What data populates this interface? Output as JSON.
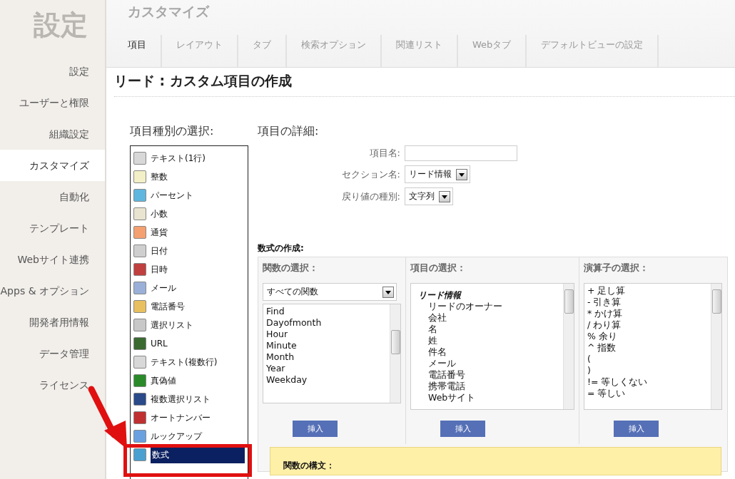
{
  "sidebar": {
    "heading": "設定",
    "items": [
      {
        "label": "設定",
        "selected": false
      },
      {
        "label": "ユーザーと権限",
        "selected": false
      },
      {
        "label": "組織設定",
        "selected": false
      },
      {
        "label": "カスタマイズ",
        "selected": true
      },
      {
        "label": "自動化",
        "selected": false
      },
      {
        "label": "テンプレート",
        "selected": false
      },
      {
        "label": "Webサイト連携",
        "selected": false
      },
      {
        "label": "Apps & オプション",
        "selected": false
      },
      {
        "label": "開発者用情報",
        "selected": false
      },
      {
        "label": "データ管理",
        "selected": false
      },
      {
        "label": "ライセンス",
        "selected": false
      }
    ]
  },
  "header": {
    "title": "カスタマイズ",
    "tabs": [
      {
        "label": "項目",
        "selected": true
      },
      {
        "label": "レイアウト",
        "selected": false
      },
      {
        "label": "タブ",
        "selected": false
      },
      {
        "label": "検索オプション",
        "selected": false
      },
      {
        "label": "関連リスト",
        "selected": false
      },
      {
        "label": "Webタブ",
        "selected": false
      },
      {
        "label": "デフォルトビューの設定",
        "selected": false
      }
    ]
  },
  "page_title": "リード : カスタム項目の作成",
  "field_types": {
    "heading": "項目種別の選択:",
    "items": [
      {
        "label": "テキスト(1行)",
        "selected": false
      },
      {
        "label": "整数",
        "selected": false
      },
      {
        "label": "パーセント",
        "selected": false
      },
      {
        "label": "小数",
        "selected": false
      },
      {
        "label": "通貨",
        "selected": false
      },
      {
        "label": "日付",
        "selected": false
      },
      {
        "label": "日時",
        "selected": false
      },
      {
        "label": "メール",
        "selected": false
      },
      {
        "label": "電話番号",
        "selected": false
      },
      {
        "label": "選択リスト",
        "selected": false
      },
      {
        "label": "URL",
        "selected": false
      },
      {
        "label": "テキスト(複数行)",
        "selected": false
      },
      {
        "label": "真偽値",
        "selected": false
      },
      {
        "label": "複数選択リスト",
        "selected": false
      },
      {
        "label": "オートナンバー",
        "selected": false
      },
      {
        "label": "ルックアップ",
        "selected": false
      },
      {
        "label": "数式",
        "selected": true
      }
    ]
  },
  "details": {
    "heading": "項目の詳細:",
    "fields": [
      {
        "label": "項目名:",
        "kind": "text"
      },
      {
        "label": "セクション名:",
        "kind": "select",
        "value": "リード情報"
      },
      {
        "label": "戻り値の種別:",
        "kind": "select",
        "value": "文字列"
      }
    ]
  },
  "formula": {
    "heading": "数式の作成:",
    "columns": [
      {
        "heading": "関数の選択：",
        "dropdown": "すべての関数",
        "items": [
          "Find",
          "Dayofmonth",
          "Hour",
          "Minute",
          "Month",
          "Year",
          "Weekday"
        ],
        "button": "挿入"
      },
      {
        "heading": "項目の選択：",
        "group": "リード情報",
        "items": [
          "リードのオーナー",
          "会社",
          "名",
          "姓",
          "件名",
          "メール",
          "電話番号",
          "携帯電話",
          "Webサイト"
        ],
        "button": "挿入"
      },
      {
        "heading": "演算子の選択：",
        "items": [
          "+ 足し算",
          "- 引き算",
          "* かけ算",
          "/ わり算",
          "% 余り",
          "^ 指数",
          "(",
          ")",
          "!= 等しくない",
          "= 等しい"
        ],
        "button": "挿入"
      }
    ],
    "syntax_heading": "関数の構文："
  }
}
